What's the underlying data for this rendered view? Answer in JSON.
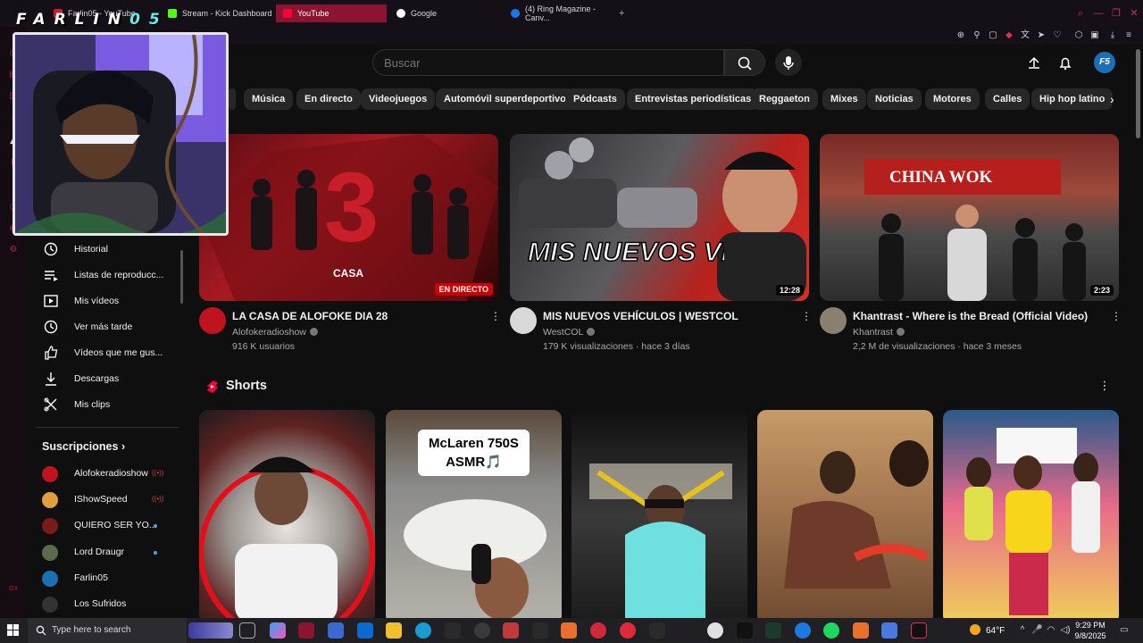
{
  "browser": {
    "tabs": [
      {
        "label": "Farlin05 - YouTube",
        "color": "#cc1f2d"
      },
      {
        "label": "Stream - Kick Dashboard",
        "color": "#53fc18"
      },
      {
        "label": "YouTube",
        "color": "#ff0033"
      },
      {
        "label": "Google",
        "color": "#ffffff"
      },
      {
        "label": "(4) Ring Magazine - Canv...",
        "color": "#1877f2"
      }
    ],
    "new_tab_label": "+"
  },
  "youtube": {
    "search_placeholder": "Buscar",
    "avatar_label": "F5",
    "chips": [
      "Música",
      "En directo",
      "Videojuegos",
      "Automóvil superdeportivo",
      "Pódcasts",
      "Entrevistas periodísticas",
      "Reggaeton",
      "Mixes",
      "Noticias",
      "Motores",
      "Calles",
      "Hip hop latino"
    ],
    "sidebar": {
      "items": [
        {
          "label": "Historial",
          "icon": "history-icon"
        },
        {
          "label": "Listas de reproducc...",
          "icon": "playlist-icon"
        },
        {
          "label": "Mis vídeos",
          "icon": "my-videos-icon"
        },
        {
          "label": "Ver más tarde",
          "icon": "watch-later-icon"
        },
        {
          "label": "Vídeos que me gus...",
          "icon": "like-icon"
        },
        {
          "label": "Descargas",
          "icon": "download-icon"
        },
        {
          "label": "Mis clips",
          "icon": "clips-icon"
        }
      ],
      "subscriptions_title": "Suscripciones",
      "subscriptions": [
        {
          "label": "Alofokeradioshow",
          "status": "live",
          "color": "#c1121f"
        },
        {
          "label": "IShowSpeed",
          "status": "live",
          "color": "#e0a040"
        },
        {
          "label": "QUIERO SER YO...",
          "status": "new",
          "color": "#7a1a1a"
        },
        {
          "label": "Lord Draugr",
          "status": "new",
          "color": "#5a6a4a"
        },
        {
          "label": "Farlin05",
          "status": "",
          "color": "#1b6fb5"
        },
        {
          "label": "Los Sufridos",
          "status": "",
          "color": "#333333"
        }
      ]
    },
    "videos": [
      {
        "title": "LA CASA DE ALOFOKE DIA 28",
        "channel": "Alofokeradioshow",
        "meta": "916 K usuarios",
        "badge": "EN DIRECTO",
        "duration": ""
      },
      {
        "title": "MIS NUEVOS VEHÍCULOS | WESTCOL",
        "channel": "WestCOL",
        "meta": "179 K visualizaciones · hace 3 días",
        "badge": "",
        "duration": "12:28",
        "thumb_text": "MIS NUEVOS VEHÍCULOS"
      },
      {
        "title": "Khantrast - Where is the Bread (Official Video)",
        "channel": "Khantrast",
        "meta": "2,2 M de visualizaciones · hace 3 meses",
        "badge": "",
        "duration": "2:23",
        "thumb_text": "CHINA WOK"
      }
    ],
    "shorts_title": "Shorts",
    "shorts": [
      {
        "overlay": ""
      },
      {
        "overlay": "McLaren 750S ASMR🎵"
      },
      {
        "overlay": ""
      },
      {
        "overlay": ""
      },
      {
        "overlay": ""
      }
    ]
  },
  "overlay": {
    "streamer_name_main": "FARLIN",
    "streamer_name_suffix": "05"
  },
  "taskbar": {
    "search_placeholder": "Type here to search",
    "weather": "64°F",
    "time": "9:29 PM",
    "date": "9/8/2025"
  }
}
